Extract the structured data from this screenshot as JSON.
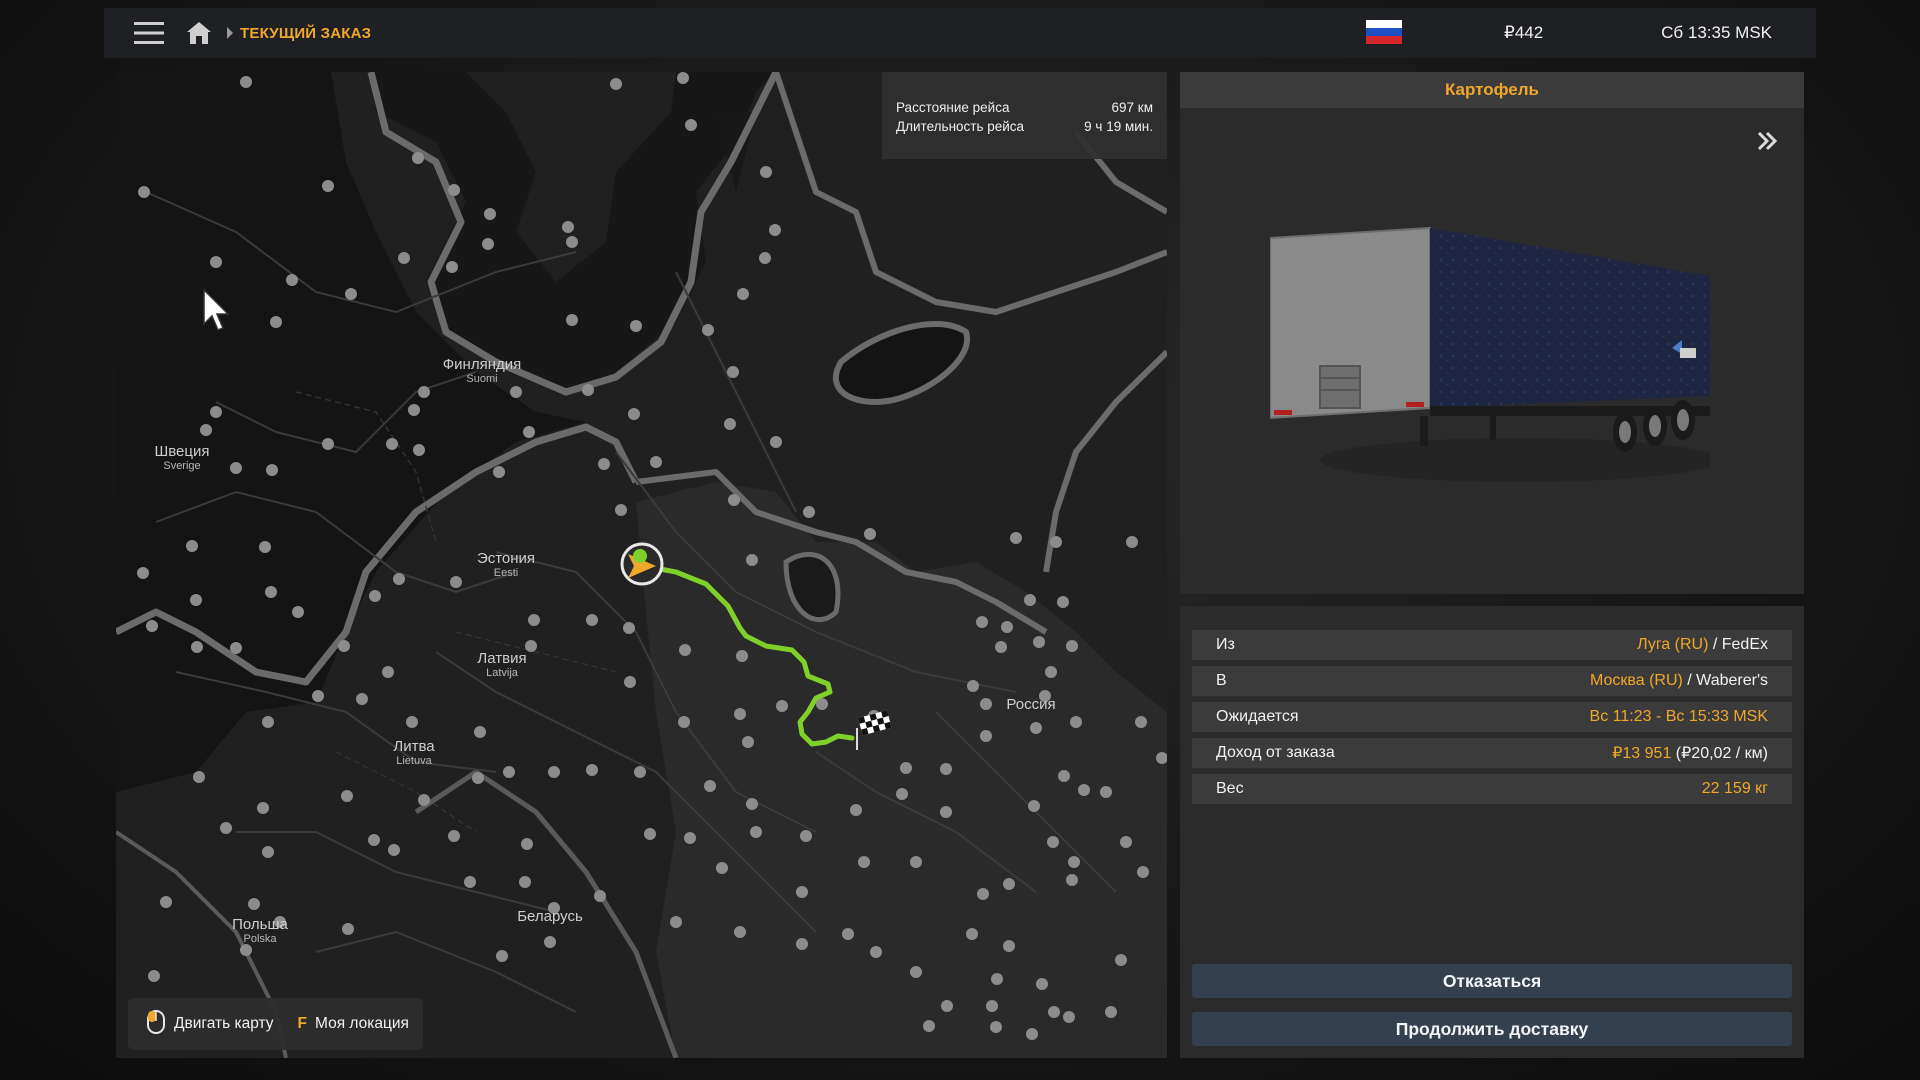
{
  "topbar": {
    "breadcrumb": "ТЕКУЩИЙ ЗАКАЗ",
    "balance": "₽442",
    "clock": "Сб 13:35 MSK"
  },
  "trip": {
    "distance_label": "Расстояние рейса",
    "distance_value": "697 км",
    "duration_label": "Длительность рейса",
    "duration_value": "9 ч 19 мин."
  },
  "map": {
    "labels": [
      {
        "name": "Финляндия",
        "sub": "Suomi"
      },
      {
        "name": "Швеция",
        "sub": "Sverige"
      },
      {
        "name": "Эстония",
        "sub": "Eesti"
      },
      {
        "name": "Латвия",
        "sub": "Latvija"
      },
      {
        "name": "Литва",
        "sub": "Lietuva"
      },
      {
        "name": "Россия",
        "sub": ""
      },
      {
        "name": "Беларусь",
        "sub": ""
      },
      {
        "name": "Польша",
        "sub": "Polska"
      }
    ],
    "controls": {
      "move_label": "Двигать карту",
      "key": "F",
      "location_label": "Моя локация"
    },
    "route_color": "#7fd12a"
  },
  "cargo": {
    "title": "Картофель"
  },
  "details": {
    "from_label": "Из",
    "from_city": "Луга (RU)",
    "from_company": " / FedEx",
    "to_label": "В",
    "to_city": "Москва (RU)",
    "to_company": " / Waberer's",
    "expected_label": "Ожидается",
    "expected_value": "Вс 11:23 - Вс 15:33 MSK",
    "income_label": "Доход от заказа",
    "income_value": "₽13 951",
    "income_rate": " (₽20,02 / км)",
    "weight_label": "Вес",
    "weight_value": "22 159 кг"
  },
  "actions": {
    "decline": "Отказаться",
    "continue": "Продолжить доставку"
  },
  "colors": {
    "accent": "#f0a82a",
    "panel": "#2b2b2b",
    "button": "#34404e"
  }
}
